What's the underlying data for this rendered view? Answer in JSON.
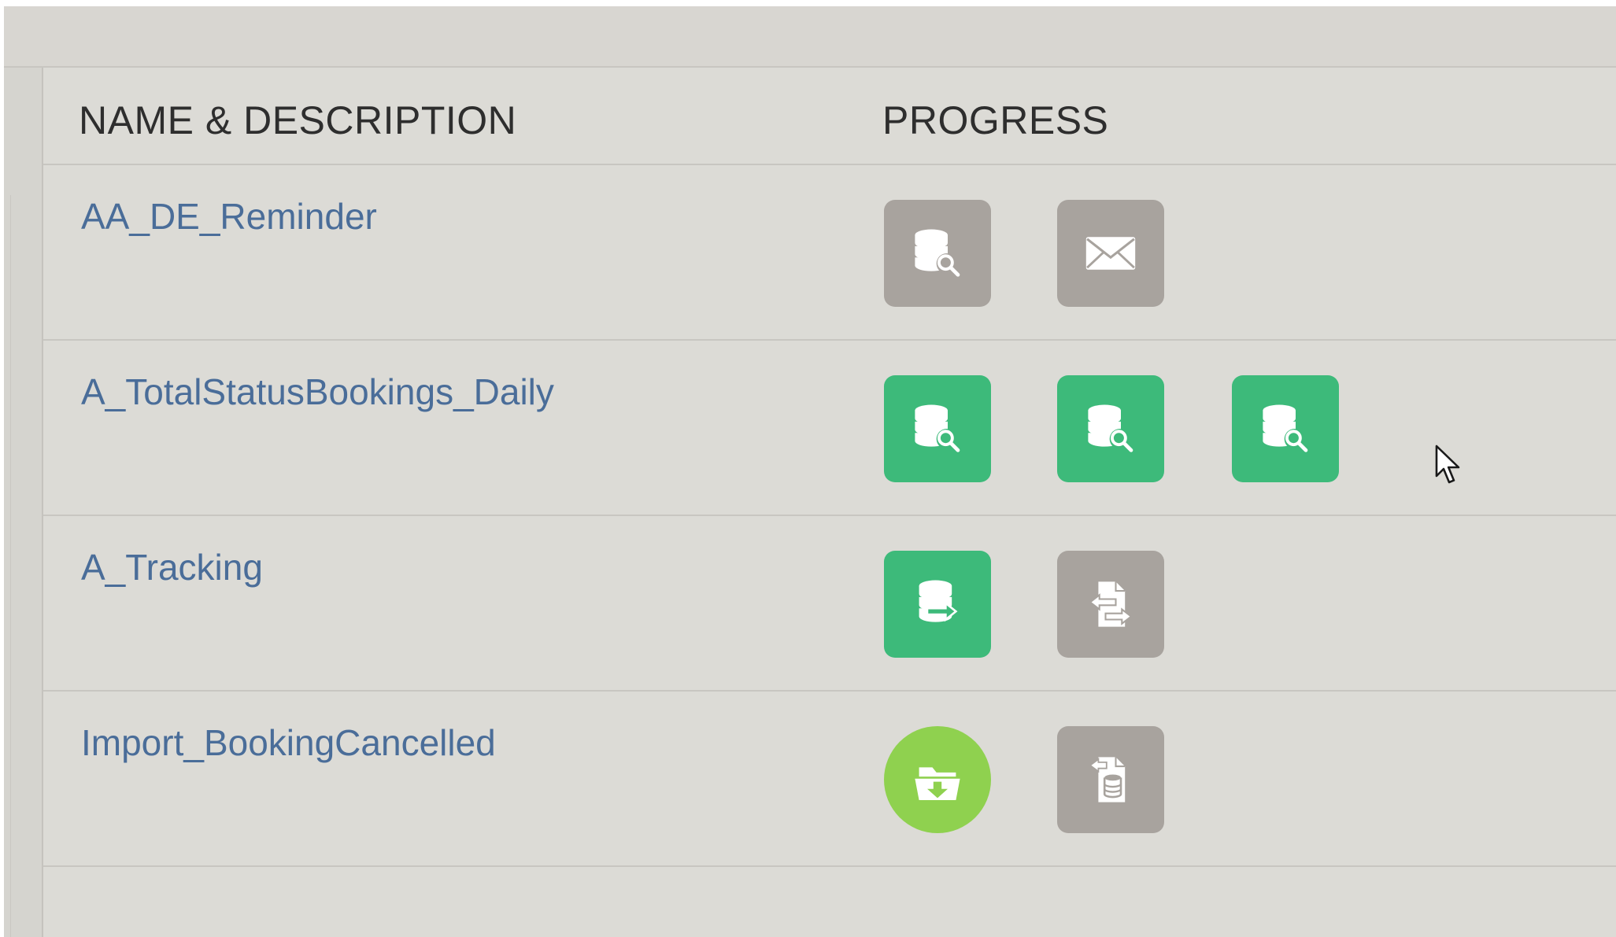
{
  "colors": {
    "link": "#4a6d99",
    "header_text": "#2e2e2e",
    "inactive_activity": "#a8a39e",
    "complete_activity": "#3dba7a",
    "import_activity": "#8fd14f",
    "icon_fg": "#ffffff"
  },
  "table": {
    "columns": {
      "name": "NAME & DESCRIPTION",
      "progress": "PROGRESS"
    },
    "rows": [
      {
        "name": "AA_DE_Reminder",
        "activities": [
          {
            "icon": "sql-query-icon",
            "status": "inactive"
          },
          {
            "icon": "email-icon",
            "status": "inactive"
          }
        ]
      },
      {
        "name": "A_TotalStatusBookings_Daily",
        "activities": [
          {
            "icon": "sql-query-icon",
            "status": "complete"
          },
          {
            "icon": "sql-query-icon",
            "status": "complete"
          },
          {
            "icon": "sql-query-icon",
            "status": "complete"
          }
        ]
      },
      {
        "name": "A_Tracking",
        "activities": [
          {
            "icon": "data-extract-icon",
            "status": "complete"
          },
          {
            "icon": "file-transfer-icon",
            "status": "inactive"
          }
        ]
      },
      {
        "name": "Import_BookingCancelled",
        "activities": [
          {
            "icon": "import-folder-icon",
            "status": "import"
          },
          {
            "icon": "import-file-icon",
            "status": "inactive"
          }
        ]
      }
    ]
  }
}
